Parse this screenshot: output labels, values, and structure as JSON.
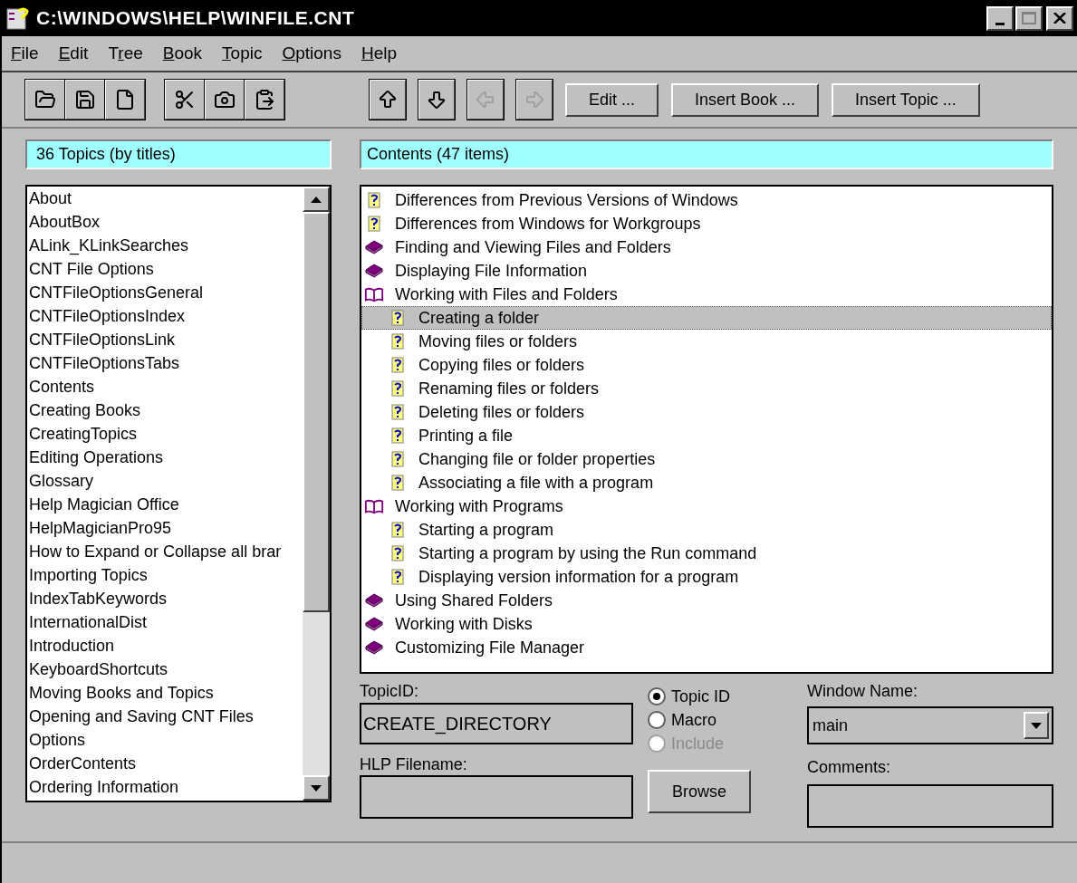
{
  "window": {
    "title": "C:\\WINDOWS\\HELP\\WINFILE.CNT"
  },
  "menu": [
    {
      "key": "F",
      "rest": "ile"
    },
    {
      "key": "E",
      "rest": "dit"
    },
    {
      "lead": "T",
      "key": "r",
      "rest": "ee"
    },
    {
      "key": "B",
      "rest": "ook"
    },
    {
      "key": "T",
      "rest": "opic"
    },
    {
      "key": "O",
      "rest": "ptions"
    },
    {
      "key": "H",
      "rest": "elp"
    }
  ],
  "toolbar": {
    "file_tools": [
      {
        "kind": "open"
      },
      {
        "kind": "save"
      },
      {
        "kind": "new"
      }
    ],
    "edit_tools": [
      {
        "kind": "cut"
      },
      {
        "kind": "camera"
      },
      {
        "kind": "paste"
      }
    ],
    "nav_tools": [
      {
        "kind": "up",
        "disabled": false
      },
      {
        "kind": "down",
        "disabled": false
      },
      {
        "kind": "left",
        "disabled": true
      },
      {
        "kind": "right",
        "disabled": true
      }
    ],
    "actions": [
      "Edit ...",
      "Insert Book ...",
      "Insert Topic ..."
    ]
  },
  "topics": {
    "header": "36 Topics (by titles)",
    "items": [
      "About",
      "AboutBox",
      "ALink_KLinkSearches",
      "CNT File Options",
      "CNTFileOptionsGeneral",
      "CNTFileOptionsIndex",
      "CNTFileOptionsLink",
      "CNTFileOptionsTabs",
      "Contents",
      "Creating Books",
      "CreatingTopics",
      "Editing Operations",
      "Glossary",
      "Help Magician Office",
      "HelpMagicianPro95",
      "How to Expand or Collapse all brar",
      "Importing Topics",
      "IndexTabKeywords",
      "InternationalDist",
      "Introduction",
      "KeyboardShortcuts",
      "Moving Books and Topics",
      "Opening and Saving CNT Files",
      "Options",
      "OrderContents",
      "Ordering Information"
    ]
  },
  "contents": {
    "header": "Contents (47 items)",
    "items": [
      {
        "kind": "topic",
        "label": "Differences from Previous Versions of Windows",
        "selected": false
      },
      {
        "kind": "topic",
        "label": "Differences from Windows for Workgroups",
        "selected": false
      },
      {
        "kind": "book",
        "label": "Finding and Viewing Files and Folders",
        "expanded": false,
        "selected": false
      },
      {
        "kind": "book",
        "label": "Displaying File Information",
        "expanded": false,
        "selected": false
      },
      {
        "kind": "book",
        "label": "Working with Files and Folders",
        "expanded": true,
        "selected": false,
        "children": [
          {
            "kind": "topic",
            "label": "Creating a folder",
            "selected": true
          },
          {
            "kind": "topic",
            "label": "Moving files or folders",
            "selected": false
          },
          {
            "kind": "topic",
            "label": "Copying files or folders",
            "selected": false
          },
          {
            "kind": "topic",
            "label": "Renaming files or folders",
            "selected": false
          },
          {
            "kind": "topic",
            "label": "Deleting files or folders",
            "selected": false
          },
          {
            "kind": "topic",
            "label": "Printing a file",
            "selected": false
          },
          {
            "kind": "topic",
            "label": "Changing file or folder properties",
            "selected": false
          },
          {
            "kind": "topic",
            "label": "Associating a file with a program",
            "selected": false
          }
        ]
      },
      {
        "kind": "book",
        "label": "Working with Programs",
        "expanded": true,
        "selected": false,
        "children": [
          {
            "kind": "topic",
            "label": "Starting a program",
            "selected": false
          },
          {
            "kind": "topic",
            "label": "Starting a program by using the Run command",
            "selected": false
          },
          {
            "kind": "topic",
            "label": "Displaying version information for a program",
            "selected": false
          }
        ]
      },
      {
        "kind": "book",
        "label": "Using Shared Folders",
        "expanded": false,
        "selected": false
      },
      {
        "kind": "book",
        "label": "Working with Disks",
        "expanded": false,
        "selected": false
      },
      {
        "kind": "book",
        "label": "Customizing File Manager",
        "expanded": false,
        "selected": false
      }
    ]
  },
  "form": {
    "topic_id": {
      "label": "TopicID:",
      "value": "CREATE_DIRECTORY"
    },
    "link_type": [
      {
        "label": "Topic ID",
        "selected": true,
        "disabled": false
      },
      {
        "label": "Macro",
        "selected": false,
        "disabled": false
      },
      {
        "label": "Include",
        "selected": false,
        "disabled": true
      }
    ],
    "window_name": {
      "label": "Window Name:",
      "value": "main"
    },
    "hlp_filename": {
      "label": "HLP Filename:"
    },
    "browse": "Browse",
    "comments": {
      "label": "Comments:"
    }
  }
}
